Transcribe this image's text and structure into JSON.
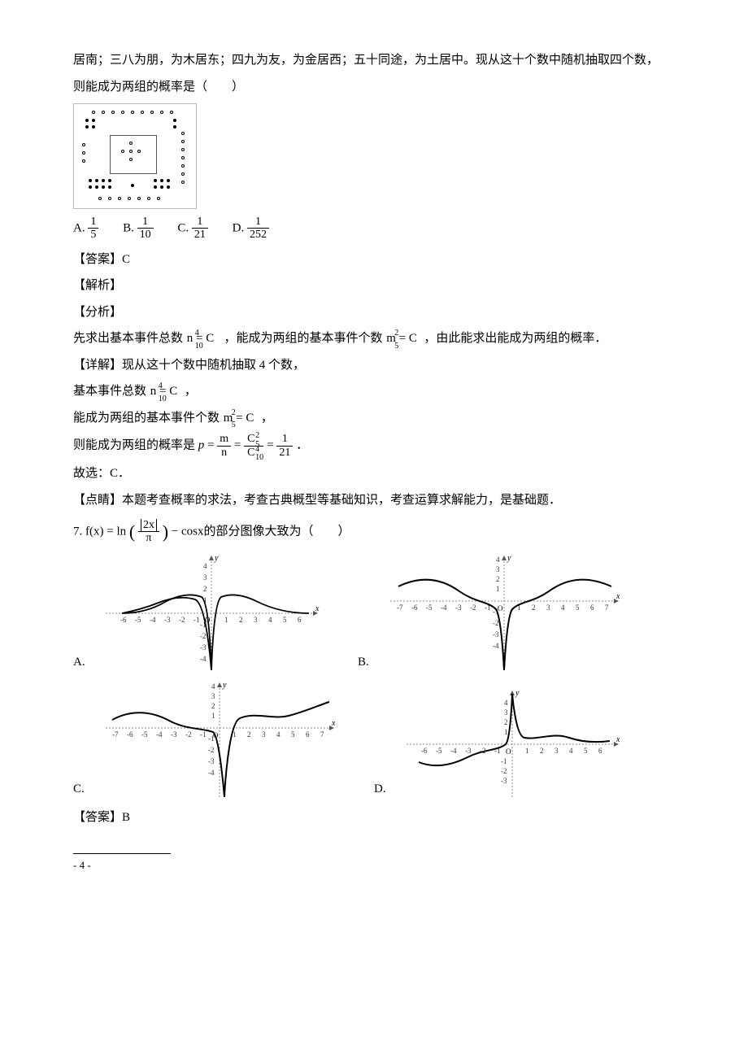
{
  "q6": {
    "stem_line1": "居南；三八为朋，为木居东；四九为友，为金居西；五十同途，为土居中。现从这十个数中随机抽取四个数，",
    "stem_line2": "则能成为两组的概率是（　　）",
    "options": {
      "A_label": "A.",
      "A_num": "1",
      "A_den": "5",
      "B_label": "B.",
      "B_num": "1",
      "B_den": "10",
      "C_label": "C.",
      "C_num": "1",
      "C_den": "21",
      "D_label": "D.",
      "D_num": "1",
      "D_den": "252"
    },
    "answer_label": "【答案】C",
    "sec_jiexi": "【解析】",
    "sec_fenxi": "【分析】",
    "fenxi_text_a": "先求出基本事件总数 ",
    "fenxi_eq1_lhs": "n = C",
    "fenxi_eq1_sub": "10",
    "fenxi_eq1_sup": "4",
    "fenxi_text_b": "，能成为两组的基本事件个数 ",
    "fenxi_eq2_lhs": "m = C",
    "fenxi_eq2_sub": "5",
    "fenxi_eq2_sup": "2",
    "fenxi_text_c": "，由此能求出能成为两组的概率．",
    "sec_xiangjie": "【详解】现从这十个数中随机抽取 4 个数，",
    "line_n_a": "基本事件总数 ",
    "line_n_eq": "n = C",
    "line_n_sub": "10",
    "line_n_sup": "4",
    "line_n_b": "，",
    "line_m_a": "能成为两组的基本事件个数 ",
    "line_m_eq": "m = C",
    "line_m_sub": "5",
    "line_m_sup": "2",
    "line_m_b": "，",
    "prob_text": "则能成为两组的概率是 ",
    "prob_p": "p",
    "prob_eq": " = ",
    "prob_f1_num": "m",
    "prob_f1_den": "n",
    "prob_f2_num_base": "C",
    "prob_f2_num_sub": "5",
    "prob_f2_num_sup": "2",
    "prob_f2_den_base": "C",
    "prob_f2_den_sub": "10",
    "prob_f2_den_sup": "4",
    "prob_f3_num": "1",
    "prob_f3_den": "21",
    "prob_period": "．",
    "guxuan": "故选：C．",
    "dianjing": "【点睛】本题考查概率的求法，考查古典概型等基础知识，考查运算求解能力，是基础题．"
  },
  "q7": {
    "stem_prefix": "7. f(x) = ln",
    "stem_frac_num": "2x",
    "stem_frac_den": "π",
    "stem_suffix": " − cosx的部分图像大致为（　　）",
    "opt_A": "A.",
    "opt_B": "B.",
    "opt_C": "C.",
    "opt_D": "D.",
    "answer_label": "【答案】B"
  },
  "chart_data": [
    {
      "type": "line",
      "label": "A",
      "xlabel": "x",
      "ylabel": "y",
      "x_ticks": [
        -6,
        -5,
        -4,
        -3,
        -2,
        -1,
        0,
        1,
        2,
        3,
        4,
        5,
        6
      ],
      "y_ticks": [
        -4,
        -3,
        -2,
        -1,
        1,
        2,
        3,
        4
      ],
      "xlim": [
        -7,
        7
      ],
      "ylim": [
        -4.5,
        4.5
      ],
      "description": "odd-looking curve: rises to small hump left of 0, steep dip to large negative spike at 0, then rises to small hump right of 0 and tails to 0"
    },
    {
      "type": "line",
      "label": "B",
      "xlabel": "x",
      "ylabel": "y",
      "x_ticks": [
        -7,
        -6,
        -5,
        -4,
        -3,
        -2,
        -1,
        0,
        1,
        2,
        3,
        4,
        5,
        6,
        7
      ],
      "y_ticks": [
        -4,
        -3,
        -2,
        -1,
        1,
        2,
        3,
        4
      ],
      "xlim": [
        -7.5,
        7.5
      ],
      "ylim": [
        -4.5,
        4.5
      ],
      "description": "even curve: two symmetric humps around ±4 above axis, deep narrow negative spike at 0"
    },
    {
      "type": "line",
      "label": "C",
      "xlabel": "x",
      "ylabel": "y",
      "x_ticks": [
        -7,
        -6,
        -5,
        -4,
        -3,
        -2,
        -1,
        0,
        1,
        2,
        3,
        4,
        5,
        6,
        7
      ],
      "y_ticks": [
        -4,
        -3,
        -2,
        -1,
        1,
        2,
        3,
        4
      ],
      "xlim": [
        -7.5,
        7.5
      ],
      "ylim": [
        -4.5,
        4.5
      ],
      "description": "left humps above axis, sharp negative spike just right of 0, then rises above axis with wavy increase"
    },
    {
      "type": "line",
      "label": "D",
      "xlabel": "x",
      "ylabel": "y",
      "x_ticks": [
        -6,
        -5,
        -4,
        -3,
        -2,
        -1,
        0,
        1,
        2,
        3,
        4,
        5,
        6
      ],
      "y_ticks": [
        -3,
        -2,
        -1,
        1,
        2,
        3,
        4
      ],
      "xlim": [
        -7,
        7
      ],
      "ylim": [
        -3.5,
        4.5
      ],
      "description": "odd-like: wavy below axis on left, steep positive spike near 0, small humps above axis on right"
    }
  ],
  "page_number": "- 4 -"
}
